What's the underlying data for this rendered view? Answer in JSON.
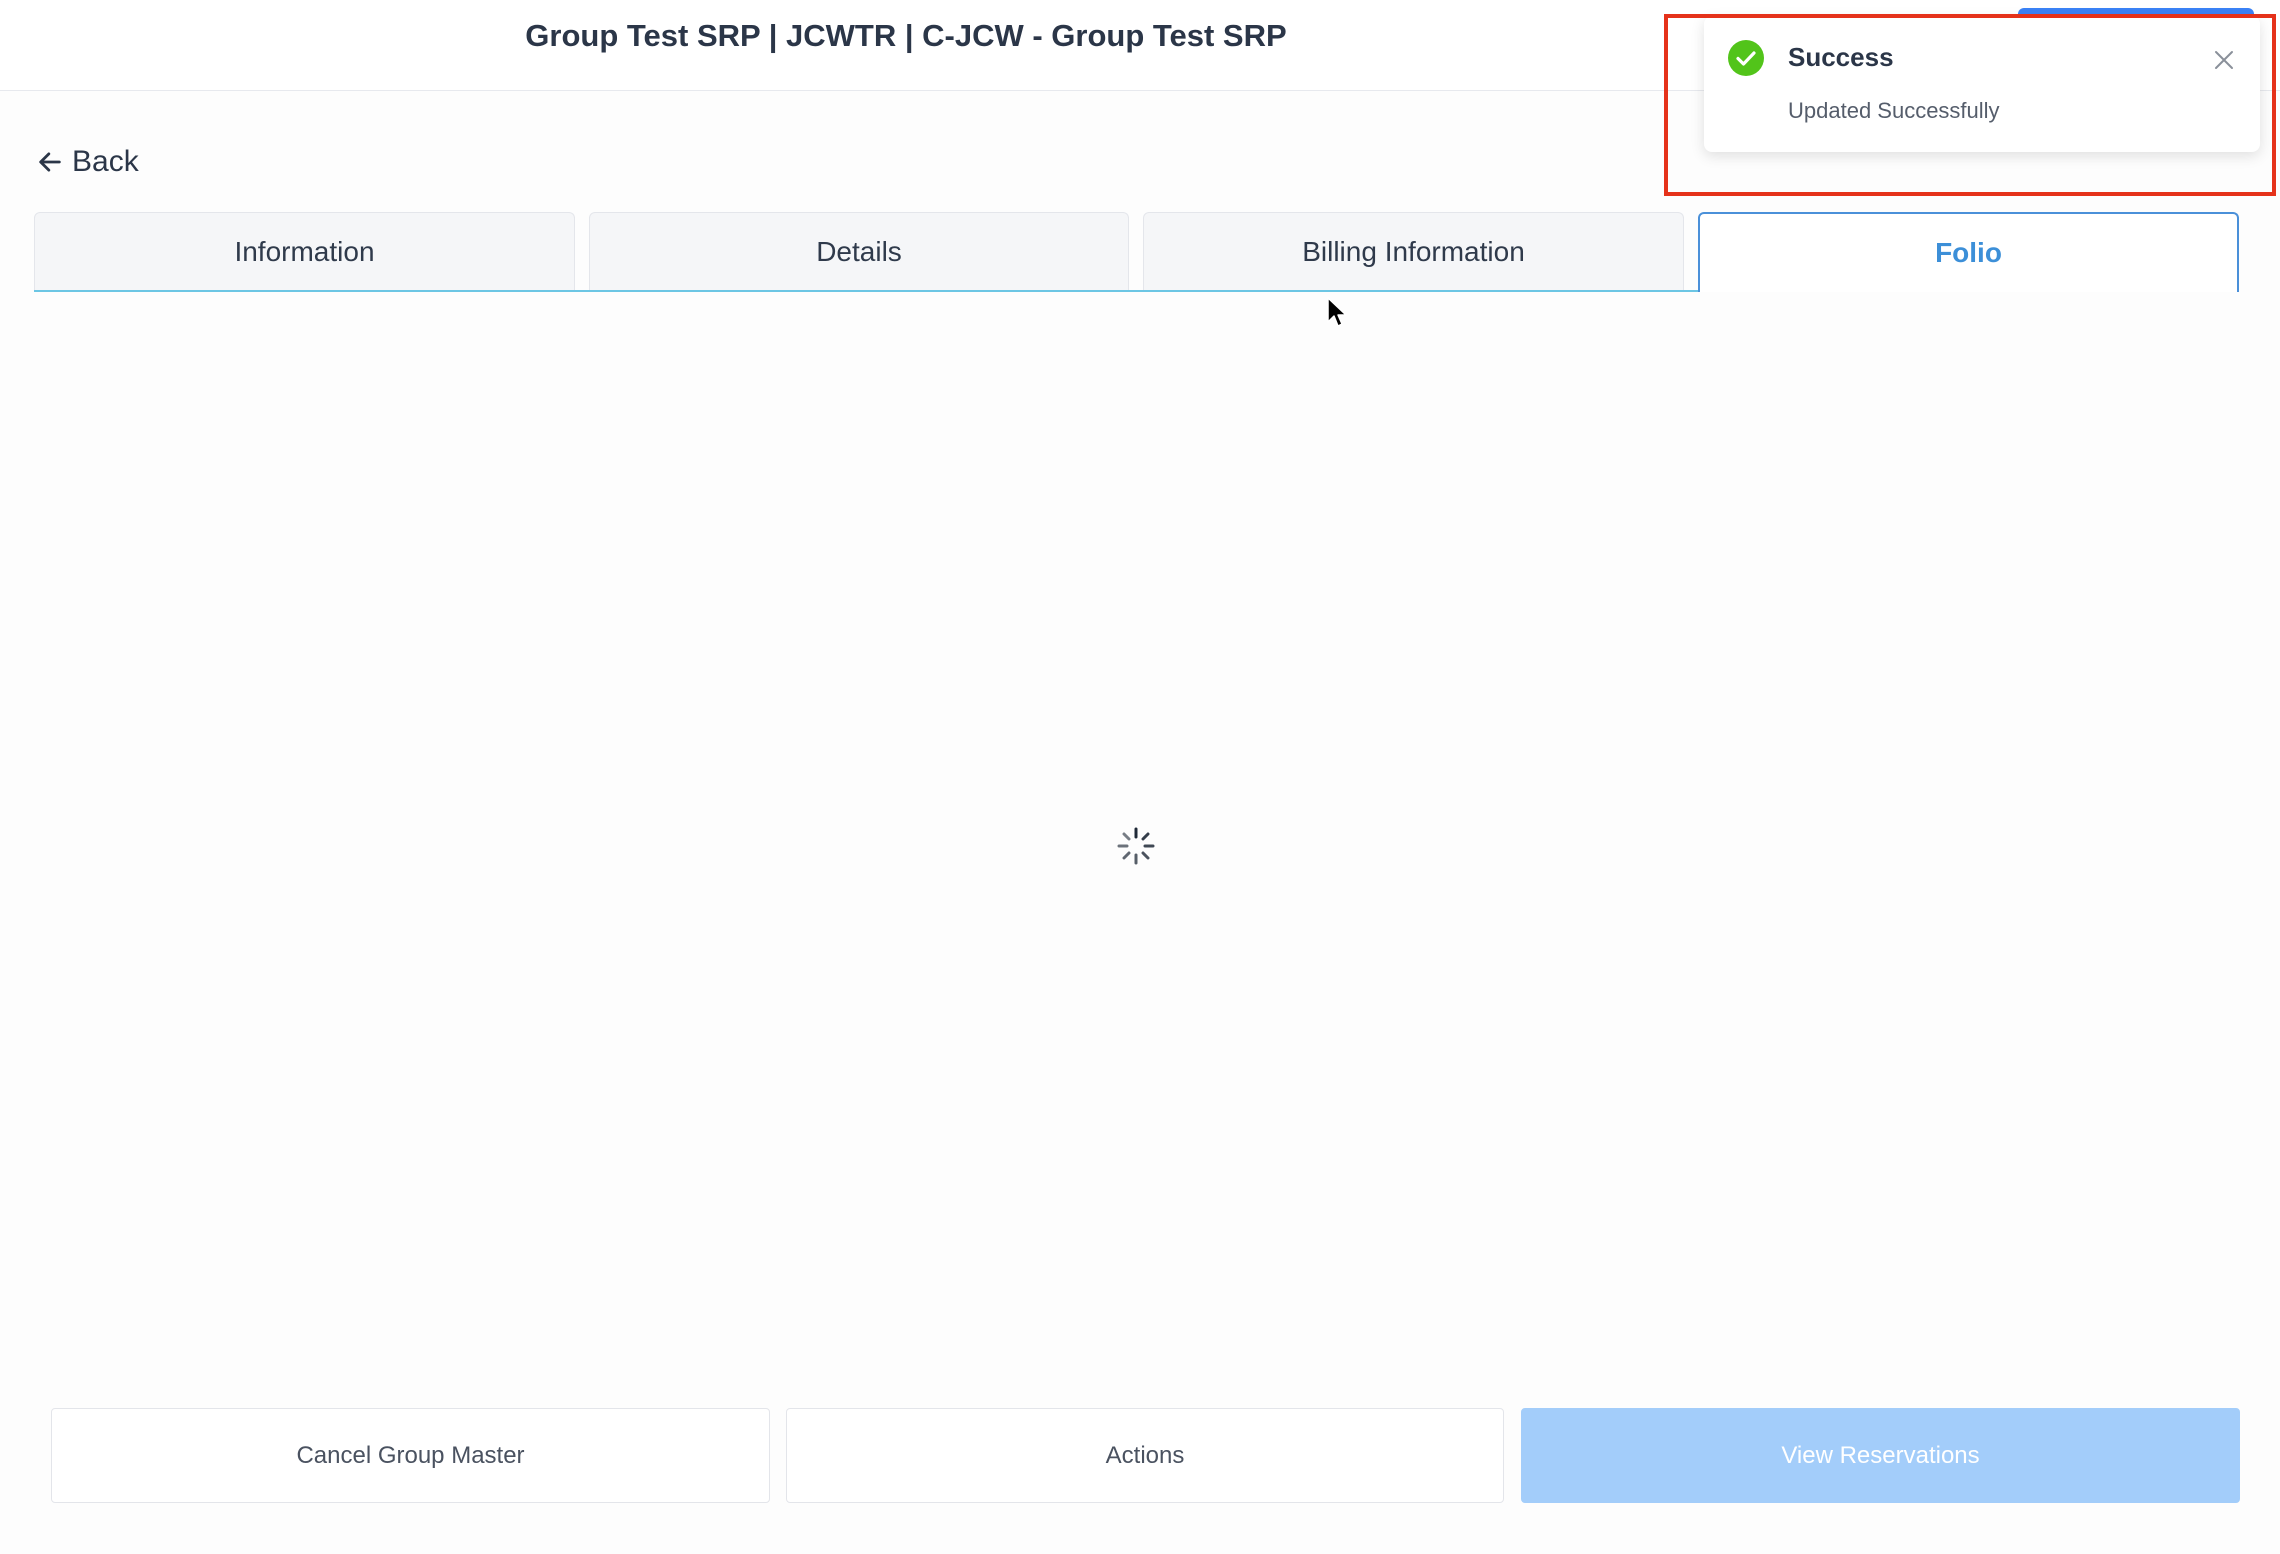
{
  "header": {
    "title": "Group Test SRP | JCWTR | C-JCW - Group Test SRP"
  },
  "nav": {
    "back_label": "Back"
  },
  "tabs": [
    {
      "label": "Information",
      "active": false
    },
    {
      "label": "Details",
      "active": false
    },
    {
      "label": "Billing Information",
      "active": false
    },
    {
      "label": "Folio",
      "active": true
    }
  ],
  "content": {
    "state": "loading"
  },
  "footer": {
    "cancel_label": "Cancel Group Master",
    "actions_label": "Actions",
    "view_reservations_label": "View Reservations"
  },
  "toast": {
    "title": "Success",
    "message": "Updated Successfully",
    "icon": "check-circle-icon"
  },
  "colors": {
    "accent": "#3c8fd8",
    "primary_disabled": "#a3cdfa",
    "success": "#52c41a",
    "highlight": "#e5321a",
    "tab_underline": "#6cc6e4"
  }
}
